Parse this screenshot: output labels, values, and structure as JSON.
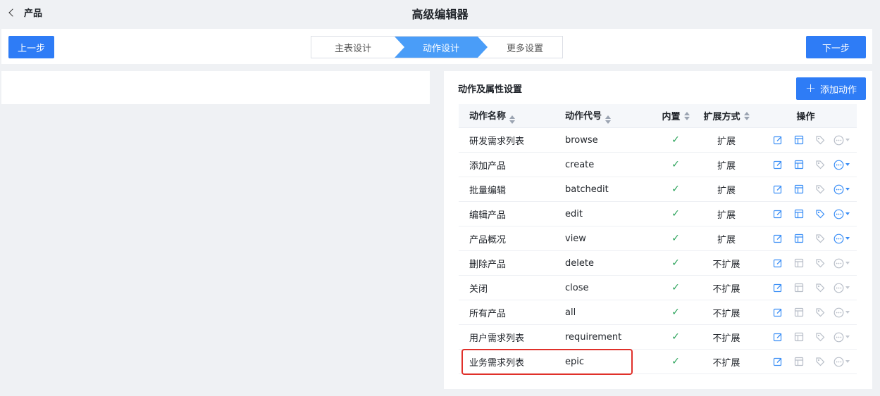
{
  "header": {
    "back_label": "产品",
    "title": "高级编辑器"
  },
  "steps": {
    "prev_label": "上一步",
    "next_label": "下一步",
    "items": [
      "主表设计",
      "动作设计",
      "更多设置"
    ],
    "active_index": 1
  },
  "panel": {
    "title": "动作及属性设置",
    "add_button_label": "添加动作",
    "add_icon": "plus-icon"
  },
  "table": {
    "columns": [
      "动作名称",
      "动作代号",
      "内置",
      "扩展方式",
      "操作"
    ],
    "rows": [
      {
        "name": "研发需求列表",
        "code": "browse",
        "builtin": "✓",
        "ext": "扩展",
        "icons_active": [
          true,
          true,
          false,
          false
        ],
        "more_active": false
      },
      {
        "name": "添加产品",
        "code": "create",
        "builtin": "✓",
        "ext": "扩展",
        "icons_active": [
          true,
          true,
          false,
          true
        ],
        "more_active": true
      },
      {
        "name": "批量编辑",
        "code": "batchedit",
        "builtin": "✓",
        "ext": "扩展",
        "icons_active": [
          true,
          true,
          false,
          true
        ],
        "more_active": true
      },
      {
        "name": "编辑产品",
        "code": "edit",
        "builtin": "✓",
        "ext": "扩展",
        "icons_active": [
          true,
          true,
          true,
          true
        ],
        "more_active": true
      },
      {
        "name": "产品概况",
        "code": "view",
        "builtin": "✓",
        "ext": "扩展",
        "icons_active": [
          true,
          true,
          false,
          true
        ],
        "more_active": true
      },
      {
        "name": "删除产品",
        "code": "delete",
        "builtin": "✓",
        "ext": "不扩展",
        "icons_active": [
          true,
          false,
          false,
          false
        ],
        "more_active": false
      },
      {
        "name": "关闭",
        "code": "close",
        "builtin": "✓",
        "ext": "不扩展",
        "icons_active": [
          true,
          false,
          false,
          false
        ],
        "more_active": false
      },
      {
        "name": "所有产品",
        "code": "all",
        "builtin": "✓",
        "ext": "不扩展",
        "icons_active": [
          true,
          false,
          false,
          false
        ],
        "more_active": false
      },
      {
        "name": "用户需求列表",
        "code": "requirement",
        "builtin": "✓",
        "ext": "不扩展",
        "icons_active": [
          true,
          false,
          false,
          false
        ],
        "more_active": false
      },
      {
        "name": "业务需求列表",
        "code": "epic",
        "builtin": "✓",
        "ext": "不扩展",
        "icons_active": [
          true,
          false,
          false,
          false
        ],
        "more_active": false
      }
    ],
    "row_icons": [
      "edit-icon",
      "layout-icon",
      "tag-icon",
      "more-icon"
    ]
  },
  "colors": {
    "primary": "#2e7cf6",
    "active_step": "#4a9df8",
    "check": "#2aa35a",
    "highlight": "#e0302a",
    "icon_active": "#3a8ef6",
    "icon_inactive": "#b8bec8"
  }
}
